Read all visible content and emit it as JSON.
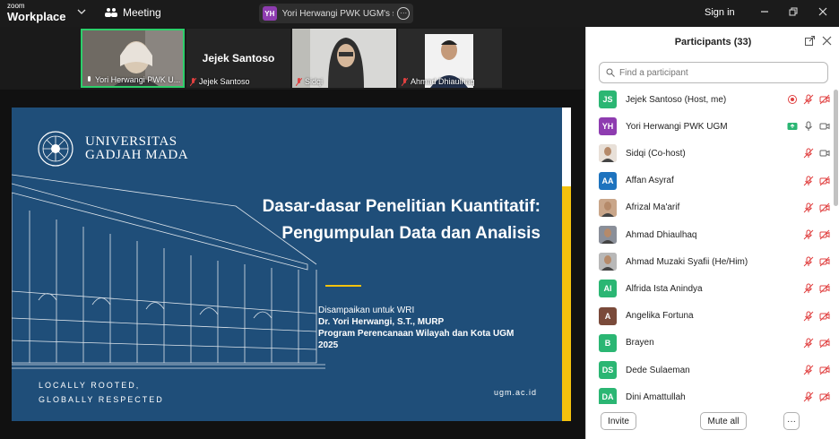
{
  "app": {
    "brand_small": "zoom",
    "brand_big": "Workplace",
    "meeting_label": "Meeting",
    "share_initials": "YH",
    "share_label": "Yori Herwangi PWK UGM's screen",
    "signin": "Sign in"
  },
  "videos": [
    {
      "name": "Yori Herwangi PWK U...",
      "active": true
    },
    {
      "name": "Jejek Santoso",
      "big_name": "Jejek Santoso"
    },
    {
      "name": "Sidqi"
    },
    {
      "name": "Ahmad Dhiaulhaq"
    }
  ],
  "slide": {
    "university_line1": "UNIVERSITAS",
    "university_line2": "GADJAH MADA",
    "title_line1": "Dasar-dasar Penelitian Kuantitatif:",
    "title_line2": "Pengumpulan Data dan Analisis",
    "presented_for": "Disampaikan untuk WRI",
    "presenter": "Dr. Yori Herwangi, S.T., MURP",
    "program": "Program Perencanaan Wilayah dan Kota UGM",
    "year": "2025",
    "tagline1": "LOCALLY ROOTED,",
    "tagline2": "GLOBALLY RESPECTED",
    "url": "ugm.ac.id"
  },
  "panel": {
    "title": "Participants (33)",
    "search_placeholder": "Find a participant",
    "invite": "Invite",
    "mute_all": "Mute all",
    "more": "···"
  },
  "participants": [
    {
      "initials": "JS",
      "name": "Jejek Santoso (Host, me)",
      "color": "#2bb673",
      "icons": [
        "record",
        "mic-off",
        "video-off"
      ]
    },
    {
      "initials": "YH",
      "name": "Yori Herwangi PWK UGM",
      "color": "#8e3cb0",
      "icons": [
        "share",
        "mic",
        "video"
      ]
    },
    {
      "initials": "",
      "name": "Sidqi (Co-host)",
      "color": "#e8e0d8",
      "photo": true,
      "icons": [
        "mic-off",
        "video"
      ]
    },
    {
      "initials": "AA",
      "name": "Affan Asyraf",
      "color": "#1e73be",
      "icons": [
        "mic-off",
        "video-off"
      ]
    },
    {
      "initials": "",
      "name": "Afrizal Ma'arif",
      "color": "#c9a68a",
      "photo": true,
      "icons": [
        "mic-off",
        "video-off"
      ]
    },
    {
      "initials": "",
      "name": "Ahmad Dhiaulhaq",
      "color": "#8a8f99",
      "photo": true,
      "icons": [
        "mic-off",
        "video-off"
      ]
    },
    {
      "initials": "",
      "name": "Ahmad Muzaki Syafii (He/Him)",
      "color": "#b8b8b8",
      "photo": true,
      "icons": [
        "mic-off",
        "video-off"
      ]
    },
    {
      "initials": "AI",
      "name": "Alfrida Ista Anindya",
      "color": "#2bb673",
      "icons": [
        "mic-off",
        "video-off"
      ]
    },
    {
      "initials": "A",
      "name": "Angelika Fortuna",
      "color": "#7a4a3a",
      "icons": [
        "mic-off",
        "video-off"
      ]
    },
    {
      "initials": "B",
      "name": "Brayen",
      "color": "#2bb673",
      "icons": [
        "mic-off",
        "video-off"
      ]
    },
    {
      "initials": "DS",
      "name": "Dede Sulaeman",
      "color": "#2bb673",
      "icons": [
        "mic-off",
        "video-off"
      ]
    },
    {
      "initials": "DA",
      "name": "Dini Amattullah",
      "color": "#2bb673",
      "icons": [
        "mic-off",
        "video-off"
      ]
    }
  ]
}
